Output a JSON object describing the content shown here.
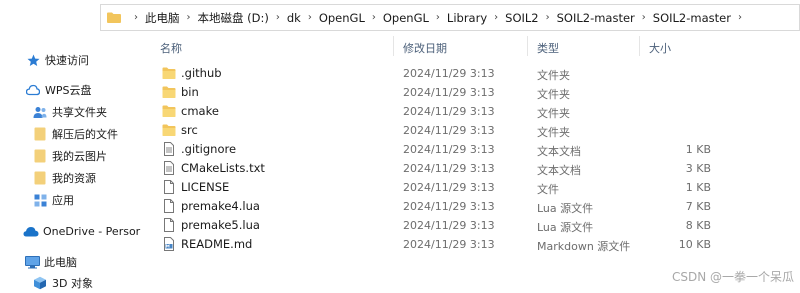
{
  "address_bar": {
    "crumbs": [
      "此电脑",
      "本地磁盘 (D:)",
      "dk",
      "OpenGL",
      "OpenGL",
      "Library",
      "SOIL2",
      "SOIL2-master",
      "SOIL2-master"
    ]
  },
  "sidebar": {
    "items": [
      {
        "label": "快速访问",
        "icon": "star-icon"
      },
      {
        "label": "WPS云盘",
        "icon": "cloud-icon"
      },
      {
        "label": "共享文件夹",
        "icon": "people-icon"
      },
      {
        "label": "解压后的文件",
        "icon": "folder-icon"
      },
      {
        "label": "我的云图片",
        "icon": "folder-icon"
      },
      {
        "label": "我的资源",
        "icon": "folder-icon"
      },
      {
        "label": "应用",
        "icon": "apps-icon"
      },
      {
        "label": "OneDrive - Persor",
        "icon": "onedrive-icon"
      },
      {
        "label": "此电脑",
        "icon": "computer-icon"
      },
      {
        "label": "3D 对象",
        "icon": "cube-icon"
      }
    ]
  },
  "columns": {
    "name": "名称",
    "date": "修改日期",
    "type": "类型",
    "size": "大小"
  },
  "files": [
    {
      "name": ".github",
      "date": "2024/11/29 3:13",
      "type": "文件夹",
      "size": "",
      "icon": "folder-icon"
    },
    {
      "name": "bin",
      "date": "2024/11/29 3:13",
      "type": "文件夹",
      "size": "",
      "icon": "folder-icon"
    },
    {
      "name": "cmake",
      "date": "2024/11/29 3:13",
      "type": "文件夹",
      "size": "",
      "icon": "folder-icon"
    },
    {
      "name": "src",
      "date": "2024/11/29 3:13",
      "type": "文件夹",
      "size": "",
      "icon": "folder-icon"
    },
    {
      "name": ".gitignore",
      "date": "2024/11/29 3:13",
      "type": "文本文档",
      "size": "1 KB",
      "icon": "document-icon"
    },
    {
      "name": "CMakeLists.txt",
      "date": "2024/11/29 3:13",
      "type": "文本文档",
      "size": "3 KB",
      "icon": "document-icon"
    },
    {
      "name": "LICENSE",
      "date": "2024/11/29 3:13",
      "type": "文件",
      "size": "1 KB",
      "icon": "file-icon"
    },
    {
      "name": "premake4.lua",
      "date": "2024/11/29 3:13",
      "type": "Lua 源文件",
      "size": "7 KB",
      "icon": "file-icon"
    },
    {
      "name": "premake5.lua",
      "date": "2024/11/29 3:13",
      "type": "Lua 源文件",
      "size": "8 KB",
      "icon": "file-icon"
    },
    {
      "name": "README.md",
      "date": "2024/11/29 3:13",
      "type": "Markdown 源文件",
      "size": "10 KB",
      "icon": "markdown-icon"
    }
  ],
  "watermark": "CSDN @一拳一个呆瓜",
  "colors": {
    "folder": "#f2c55c",
    "header_text": "#4c607a",
    "meta_text": "#6d6d6d",
    "accent": "#0078d4"
  }
}
